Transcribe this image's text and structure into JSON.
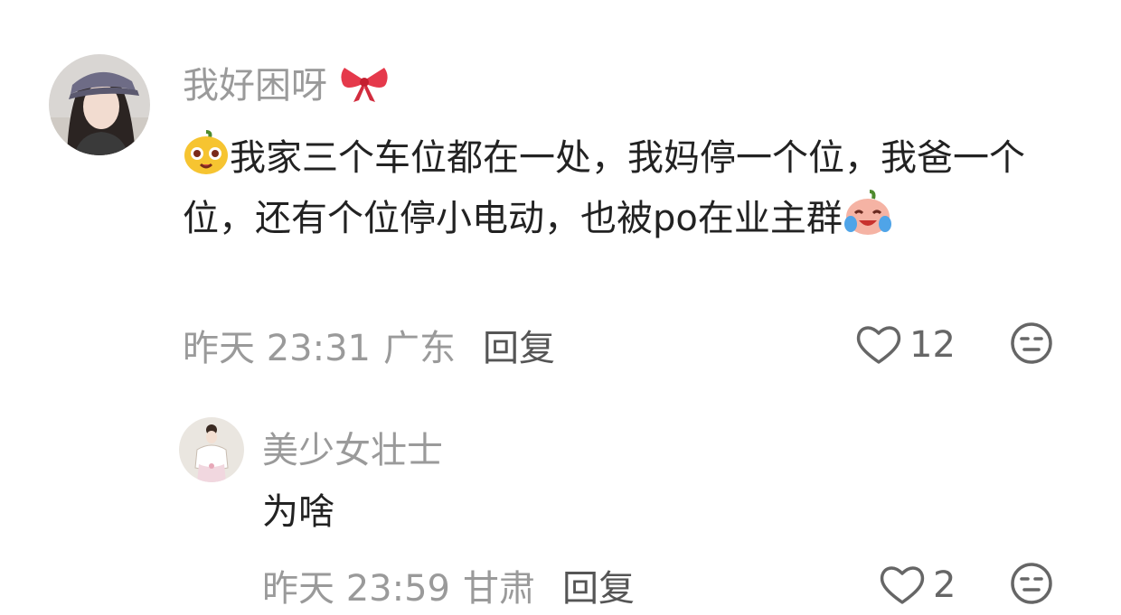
{
  "comment": {
    "username": "我好困呀",
    "username_emoji": "bow-emoji",
    "text_prefix_emoji": "orange-face-emoji",
    "text": "我家三个车位都在一处，我妈停一个位，我爸一个位，还有个位停小电动，也被po在业主群",
    "text_suffix_emoji": "crying-laughing-emoji",
    "time": "昨天 23:31",
    "location": "广东",
    "reply_label": "回复",
    "likes": "12"
  },
  "reply_comment": {
    "username": "美少女壮士",
    "text": "为啥",
    "time": "昨天 23:59",
    "location": "甘肃",
    "reply_label": "回复",
    "likes": "2"
  },
  "colors": {
    "username": "#9a9a9a",
    "text": "#222222",
    "meta": "#9a9a9a",
    "icon": "#666666"
  }
}
